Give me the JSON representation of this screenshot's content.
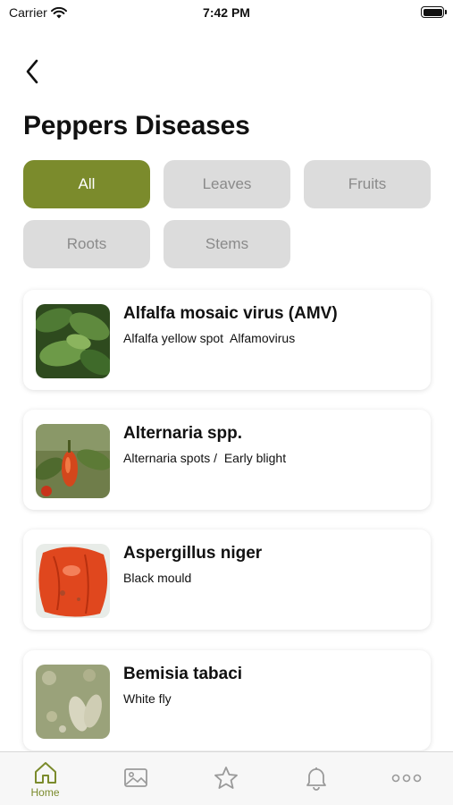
{
  "status": {
    "carrier": "Carrier",
    "time": "7:42 PM"
  },
  "header": {
    "title": "Peppers Diseases"
  },
  "filters": [
    {
      "label": "All",
      "active": true
    },
    {
      "label": "Leaves",
      "active": false
    },
    {
      "label": "Fruits",
      "active": false
    },
    {
      "label": "Roots",
      "active": false
    },
    {
      "label": "Stems",
      "active": false
    }
  ],
  "diseases": [
    {
      "title": "Alfalfa mosaic virus (AMV)",
      "subtitle": "Alfalfa yellow spot  Alfamovirus",
      "image": "green-leaves-photo"
    },
    {
      "title": "Alternaria spp.",
      "subtitle": "Alternaria spots /  Early blight",
      "image": "pepper-plant-photo"
    },
    {
      "title": "Aspergillus niger",
      "subtitle": "Black mould",
      "image": "red-pepper-photo"
    },
    {
      "title": "Bemisia tabaci",
      "subtitle": "White fly",
      "image": "whitefly-leaf-photo"
    }
  ],
  "tabbar": {
    "items": [
      {
        "name": "home",
        "label": "Home",
        "icon": "home-icon",
        "active": true
      },
      {
        "name": "gallery",
        "label": "",
        "icon": "image-icon",
        "active": false
      },
      {
        "name": "favorites",
        "label": "",
        "icon": "star-icon",
        "active": false
      },
      {
        "name": "notifications",
        "label": "",
        "icon": "bell-icon",
        "active": false
      },
      {
        "name": "more",
        "label": "",
        "icon": "more-icon",
        "active": false
      }
    ]
  },
  "colors": {
    "accent": "#7b8b2c",
    "chip_bg": "#dcdcdc",
    "chip_text": "#8a8a8a",
    "icon_gray": "#9a9a9a"
  }
}
